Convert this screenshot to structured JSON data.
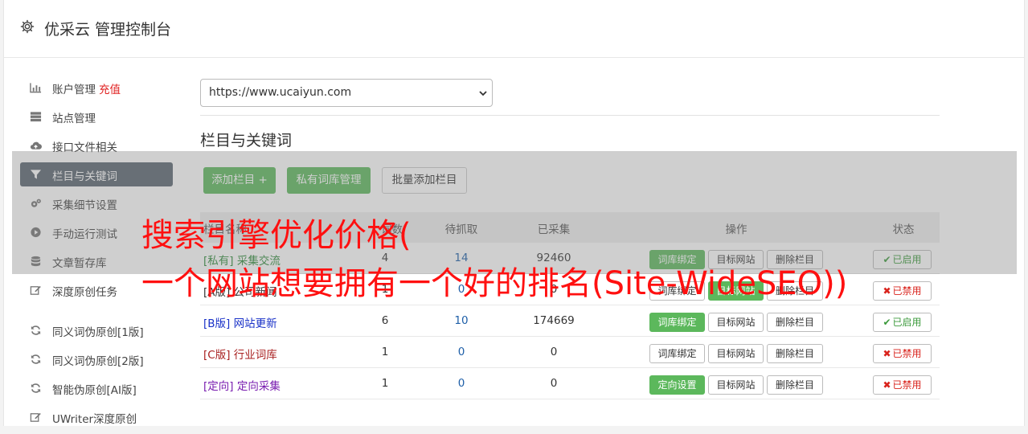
{
  "header": {
    "icon": "gear-icon",
    "title": "优采云 管理控制台"
  },
  "sidebar": {
    "items": [
      {
        "label": "账户管理",
        "extra": "充值",
        "icon": "bar-chart-icon",
        "active": false
      },
      {
        "label": "站点管理",
        "icon": "server-icon",
        "active": false
      },
      {
        "label": "接口文件相关",
        "icon": "cloud-upload-icon",
        "active": false
      },
      {
        "label": "栏目与关键词",
        "icon": "filter-icon",
        "active": true
      },
      {
        "label": "采集细节设置",
        "icon": "cogs-icon",
        "active": false
      },
      {
        "label": "手动运行测试",
        "icon": "play-circle-icon",
        "active": false
      },
      {
        "label": "文章暂存库",
        "icon": "database-icon",
        "active": false
      },
      {
        "label": "深度原创任务",
        "icon": "edit-icon",
        "active": false
      }
    ],
    "items2": [
      {
        "label": "同义词伪原创[1版]",
        "icon": "refresh-icon"
      },
      {
        "label": "同义词伪原创[2版]",
        "icon": "refresh-icon"
      },
      {
        "label": "智能伪原创[AI版]",
        "icon": "refresh-icon"
      },
      {
        "label": "UWriter深度原创",
        "icon": "edit-icon"
      }
    ]
  },
  "main": {
    "site_select": "https://www.ucaiyun.com",
    "section_title": "栏目与关键词",
    "buttons": {
      "add": "添加栏目 +",
      "private": "私有词库管理",
      "batch": "批量添加栏目"
    }
  },
  "table": {
    "headers": {
      "name": "栏目名称",
      "n1": "词数",
      "n2": "待抓取",
      "n3": "已采集",
      "op": "操作",
      "status": "状态"
    },
    "rows": [
      {
        "tag": "[私有]",
        "name": "采集交流",
        "color": "#2e8b3a",
        "n1": "4",
        "n2": "14",
        "n3": "92460",
        "op1": "词库绑定",
        "op1_green": true,
        "op2": "目标网站",
        "op3": "删除栏目",
        "status": "已启用",
        "enabled": true
      },
      {
        "tag": "[A版]",
        "name": "公司新闻",
        "color": "#333333",
        "n1": "1",
        "n2": "0",
        "n3": "0",
        "op1": "词库绑定",
        "op1_green": false,
        "op2": "目标网站",
        "op3": "删除栏目",
        "op2_green": true,
        "status": "已禁用",
        "enabled": false
      },
      {
        "tag": "[B版]",
        "name": "网站更新",
        "color": "#1a32c8",
        "n1": "6",
        "n2": "10",
        "n3": "174669",
        "op1": "词库绑定",
        "op1_green": true,
        "op2": "目标网站",
        "op3": "删除栏目",
        "status": "已启用",
        "enabled": true
      },
      {
        "tag": "[C版]",
        "name": "行业词库",
        "color": "#a82020",
        "n1": "1",
        "n2": "0",
        "n3": "0",
        "op1": "词库绑定",
        "op1_green": false,
        "op2": "目标网站",
        "op3": "删除栏目",
        "status": "已禁用",
        "enabled": false
      },
      {
        "tag": "[定向]",
        "name": "定向采集",
        "color": "#7a1fb0",
        "n1": "1",
        "n2": "0",
        "n3": "0",
        "op1": "定向设置",
        "op1_green": true,
        "op2": "目标网站",
        "op3": "删除栏目",
        "status": "已禁用",
        "enabled": false
      }
    ]
  },
  "watermark": {
    "line1": "搜索引擎优化价格(",
    "line2": "一个网站想要拥有一个好的排名(Site-WideSEO))"
  }
}
